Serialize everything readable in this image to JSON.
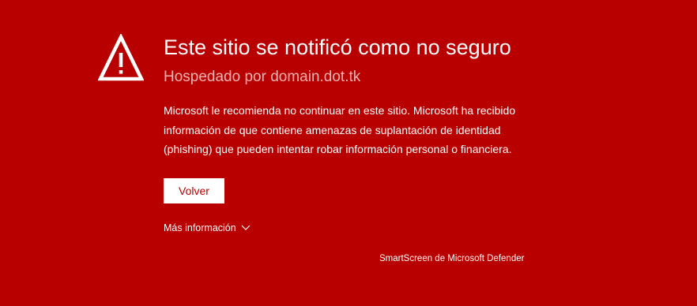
{
  "colors": {
    "background": "#b80000",
    "subtitle": "#f0b3b3",
    "button_bg": "#ffffff",
    "button_text": "#b80000"
  },
  "header": {
    "icon": "warning-triangle-icon",
    "title": "Este sitio se notificó como no seguro",
    "subtitle": "Hospedado por domain.dot.tk"
  },
  "body": {
    "description": "Microsoft le recomienda no continuar en este sitio. Microsoft ha recibido información de que contiene amenazas de suplantación de identidad (phishing) que pueden intentar robar información personal o financiera."
  },
  "actions": {
    "back_label": "Volver",
    "more_info_label": "Más información",
    "more_info_icon": "chevron-down-icon"
  },
  "footer": {
    "brand": "SmartScreen de Microsoft Defender"
  }
}
